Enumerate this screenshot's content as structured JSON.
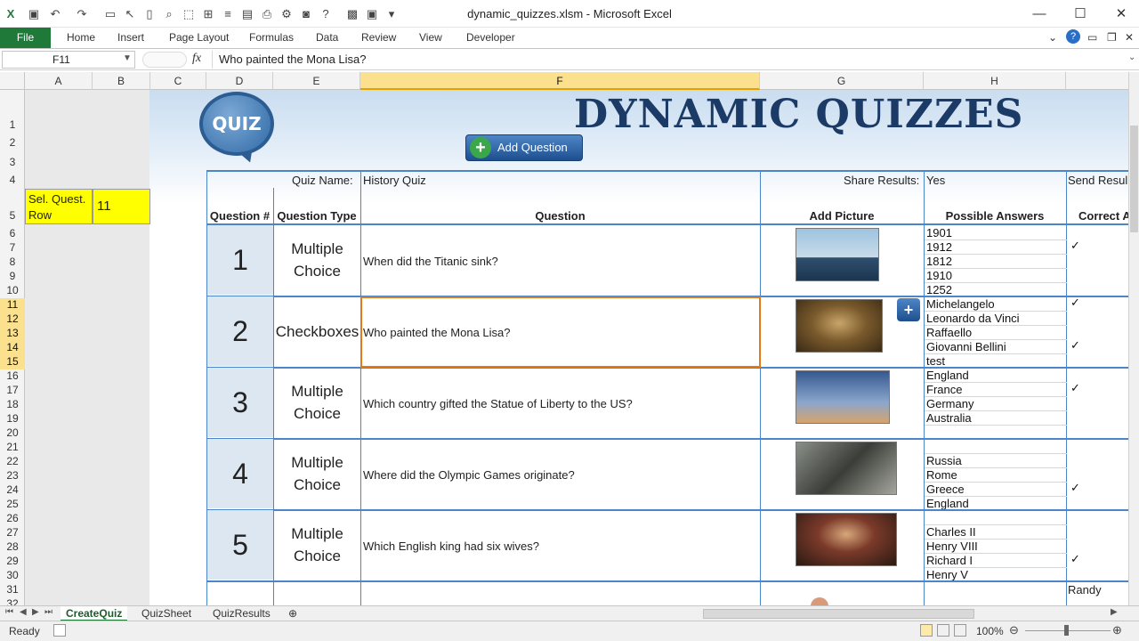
{
  "window": {
    "title": "dynamic_quizzes.xlsm  -  Microsoft Excel"
  },
  "ribbon": {
    "file": "File",
    "tabs": [
      "Home",
      "Insert",
      "Page Layout",
      "Formulas",
      "Data",
      "Review",
      "View",
      "Developer"
    ]
  },
  "formula_bar": {
    "name_box": "F11",
    "fx": "fx",
    "formula": "Who painted the Mona Lisa?"
  },
  "columns": [
    "A",
    "B",
    "C",
    "D",
    "E",
    "F",
    "G",
    "H"
  ],
  "rows": [
    "1",
    "2",
    "3",
    "4",
    "5",
    "6",
    "7",
    "8",
    "9",
    "10",
    "11",
    "12",
    "13",
    "14",
    "15",
    "16",
    "17",
    "18",
    "19",
    "20",
    "21",
    "22",
    "23",
    "24",
    "25",
    "26",
    "27",
    "28",
    "29",
    "30",
    "31",
    "32"
  ],
  "selector": {
    "label": "Sel. Quest. Row",
    "value": "11"
  },
  "logo_text": "QUIZ",
  "title": "DYNAMIC QUIZZES",
  "add_question": "Add Question",
  "header": {
    "quiz_name_label": "Quiz Name:",
    "quiz_name": "History Quiz",
    "share_label": "Share Results:",
    "share_value": "Yes",
    "send_label": "Send Resul"
  },
  "table_headers": {
    "num": "Question #",
    "type": "Question Type",
    "question": "Question",
    "picture": "Add Picture",
    "answers": "Possible Answers",
    "correct": "Correct A"
  },
  "questions": [
    {
      "num": "1",
      "type_a": "Multiple",
      "type_b": "Choice",
      "text": "When did the Titanic sink?",
      "answers": [
        "1901",
        "1912",
        "1812",
        "1910",
        "1252"
      ],
      "correct": [
        1
      ]
    },
    {
      "num": "2",
      "type_a": "Checkboxes",
      "type_b": "",
      "text": "Who painted the Mona Lisa?",
      "answers": [
        "Michelangelo",
        "Leonardo da Vinci",
        "Raffaello",
        "Giovanni Bellini",
        "test"
      ],
      "correct": [
        0,
        3
      ]
    },
    {
      "num": "3",
      "type_a": "Multiple",
      "type_b": "Choice",
      "text": "Which country gifted the Statue of Liberty to the US?",
      "answers": [
        "England",
        "France",
        "Germany",
        "Australia",
        ""
      ],
      "correct": [
        1
      ]
    },
    {
      "num": "4",
      "type_a": "Multiple",
      "type_b": "Choice",
      "text": "Where did the Olympic Games originate?",
      "answers": [
        "",
        "Russia",
        "Rome",
        "Greece",
        "England"
      ],
      "correct": [
        3
      ]
    },
    {
      "num": "5",
      "type_a": "Multiple",
      "type_b": "Choice",
      "text": "Which English king had six wives?",
      "answers": [
        "",
        "Charles II",
        "Henry VIII",
        "Richard I",
        "Henry V"
      ],
      "correct": [
        3
      ]
    }
  ],
  "checkmark": "✓",
  "extra_cell": "Randy",
  "sheet_tabs": [
    "CreateQuiz",
    "QuizSheet",
    "QuizResults"
  ],
  "status": {
    "ready": "Ready",
    "zoom": "100%"
  }
}
